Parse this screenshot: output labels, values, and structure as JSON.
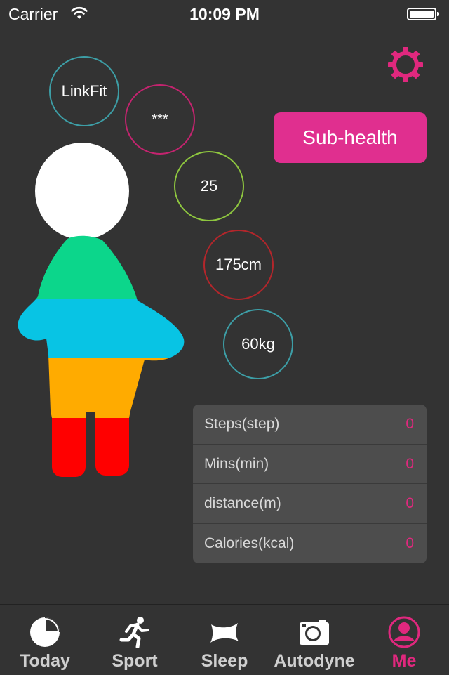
{
  "status_bar": {
    "carrier": "Carrier",
    "time": "10:09 PM"
  },
  "profile": {
    "name": "LinkFit",
    "password": "***",
    "age": "25",
    "height": "175cm",
    "weight": "60kg",
    "health_status": "Sub-health"
  },
  "stats": {
    "rows": [
      {
        "label": "Steps(step)",
        "value": "0"
      },
      {
        "label": "Mins(min)",
        "value": "0"
      },
      {
        "label": "distance(m)",
        "value": "0"
      },
      {
        "label": "Calories(kcal)",
        "value": "0"
      }
    ]
  },
  "tabs": [
    {
      "label": "Today",
      "icon": "pie-clock-icon"
    },
    {
      "label": "Sport",
      "icon": "runner-icon"
    },
    {
      "label": "Sleep",
      "icon": "pillow-icon"
    },
    {
      "label": "Autodyne",
      "icon": "camera-icon"
    },
    {
      "label": "Me",
      "icon": "person-icon"
    }
  ],
  "active_tab": "Me",
  "colors": {
    "accent": "#e0287e",
    "background": "#333333",
    "body_bands": [
      "#0cd68b",
      "#08c4e4",
      "#ffab00",
      "#ff0000"
    ]
  }
}
